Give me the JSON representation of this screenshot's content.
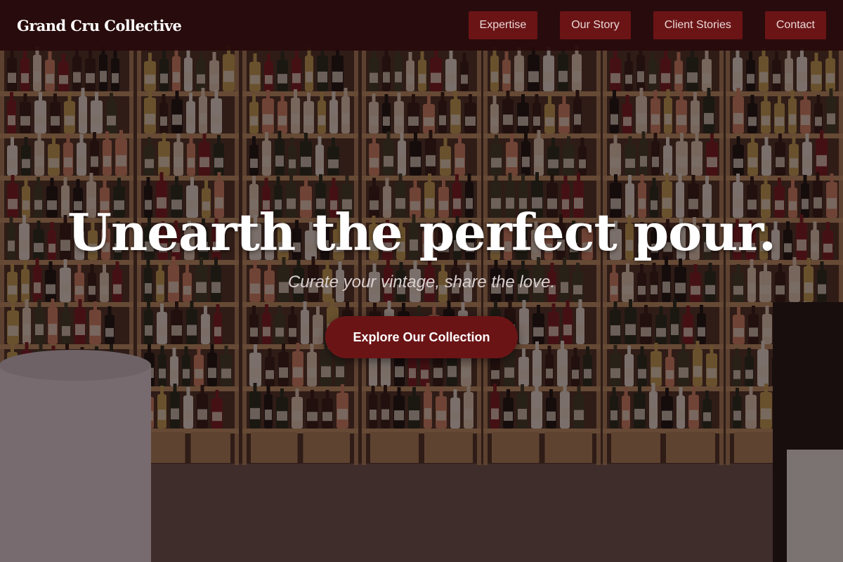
{
  "header": {
    "brand": "Grand Cru Collective",
    "nav": [
      {
        "label": "Expertise"
      },
      {
        "label": "Our Story"
      },
      {
        "label": "Client Stories"
      },
      {
        "label": "Contact"
      }
    ]
  },
  "hero": {
    "title": "Unearth the perfect pour.",
    "subtitle": "Curate your vintage, share the love.",
    "cta_label": "Explore Our Collection"
  },
  "colors": {
    "accent": "#6b1416",
    "header_bg": "#2a0a0c",
    "text_light": "#ffffff"
  }
}
